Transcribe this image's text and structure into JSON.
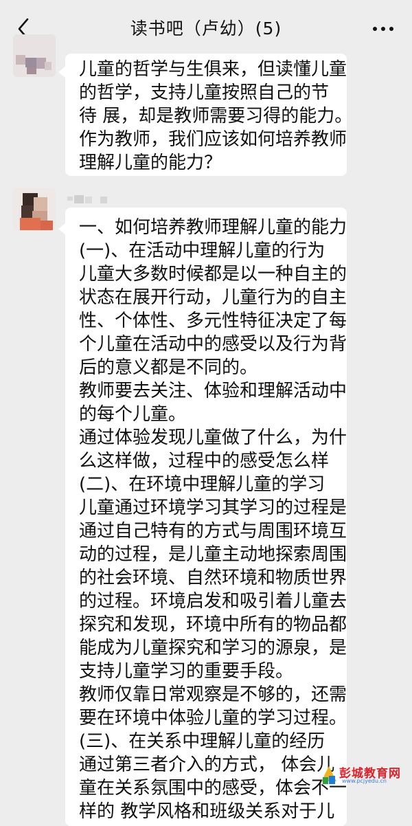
{
  "header": {
    "title": "读书吧（卢幼）(5)"
  },
  "messages": [
    {
      "lines": [
        "儿童的哲学与生俱来，但读懂儿童",
        "的哲学，支持儿童按照自己的节",
        "待 展，却是教师需要习得的能力。",
        "作为教师，我们应该如何培养教师",
        "理解儿童的能力？"
      ]
    },
    {
      "lines": [
        "一、如何培养教师理解儿童的能力",
        "(一)、在活动中理解儿童的行为",
        "儿童大多数时候都是以一种自主的",
        "状态在展开行动，儿童行为的自主",
        "性、个体性、多元性特征决定了每",
        "个儿童在活动中的感受以及行为背",
        "后的意义都是不同的。",
        "教师要去关注、体验和理解活动中",
        "的每个儿童。",
        "通过体验发现儿童做了什么，为什",
        "么这样做，过程中的感受怎么样",
        "(二)、在环境中理解儿童的学习",
        "儿童通过环境学习其学习的过程是",
        "通过自己特有的方式与周围环境互",
        "动的过程，是儿童主动地探索周围",
        "的社会环境、自然环境和物质世界",
        "的过程。环境启发和吸引着儿童去",
        "探究和发现，环境中所有的物品都",
        "能成为儿童探究和学习的源泉，是",
        "支持儿童学习的重要手段。",
        "教师仅靠日常观察是不够的，还需",
        "要在环境中体验儿童的学习过程。",
        "(三)、在关系中理解儿童的经历",
        "通过第三者介入的方式， 体会儿",
        "童在关系氛围中的感受，体会不一",
        "样的 教学风格和班级关系对于儿"
      ]
    }
  ],
  "watermark": {
    "name": "彭城教育网",
    "url": "www.pcjyedu.cn"
  }
}
